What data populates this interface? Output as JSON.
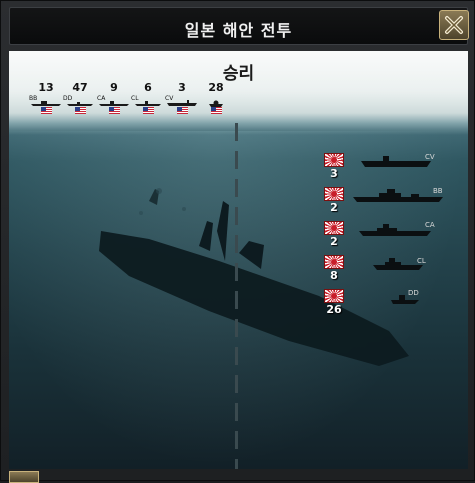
{
  "window": {
    "title": "일본 해안 전투"
  },
  "battle": {
    "result": "승리"
  },
  "allied": [
    {
      "type": "BB",
      "count": "13"
    },
    {
      "type": "DD",
      "count": "47"
    },
    {
      "type": "CA",
      "count": "9"
    },
    {
      "type": "CL",
      "count": "6"
    },
    {
      "type": "CV",
      "count": "3"
    },
    {
      "type": "",
      "count": "28"
    }
  ],
  "axis": [
    {
      "type": "CV",
      "count": "3"
    },
    {
      "type": "BB",
      "count": "2"
    },
    {
      "type": "CA",
      "count": "2"
    },
    {
      "type": "CL",
      "count": "8"
    },
    {
      "type": "DD",
      "count": "26"
    }
  ],
  "icons": {
    "close": "close-icon",
    "allied_flag": "us-flag-icon",
    "axis_flag": "japan-flag-icon"
  }
}
